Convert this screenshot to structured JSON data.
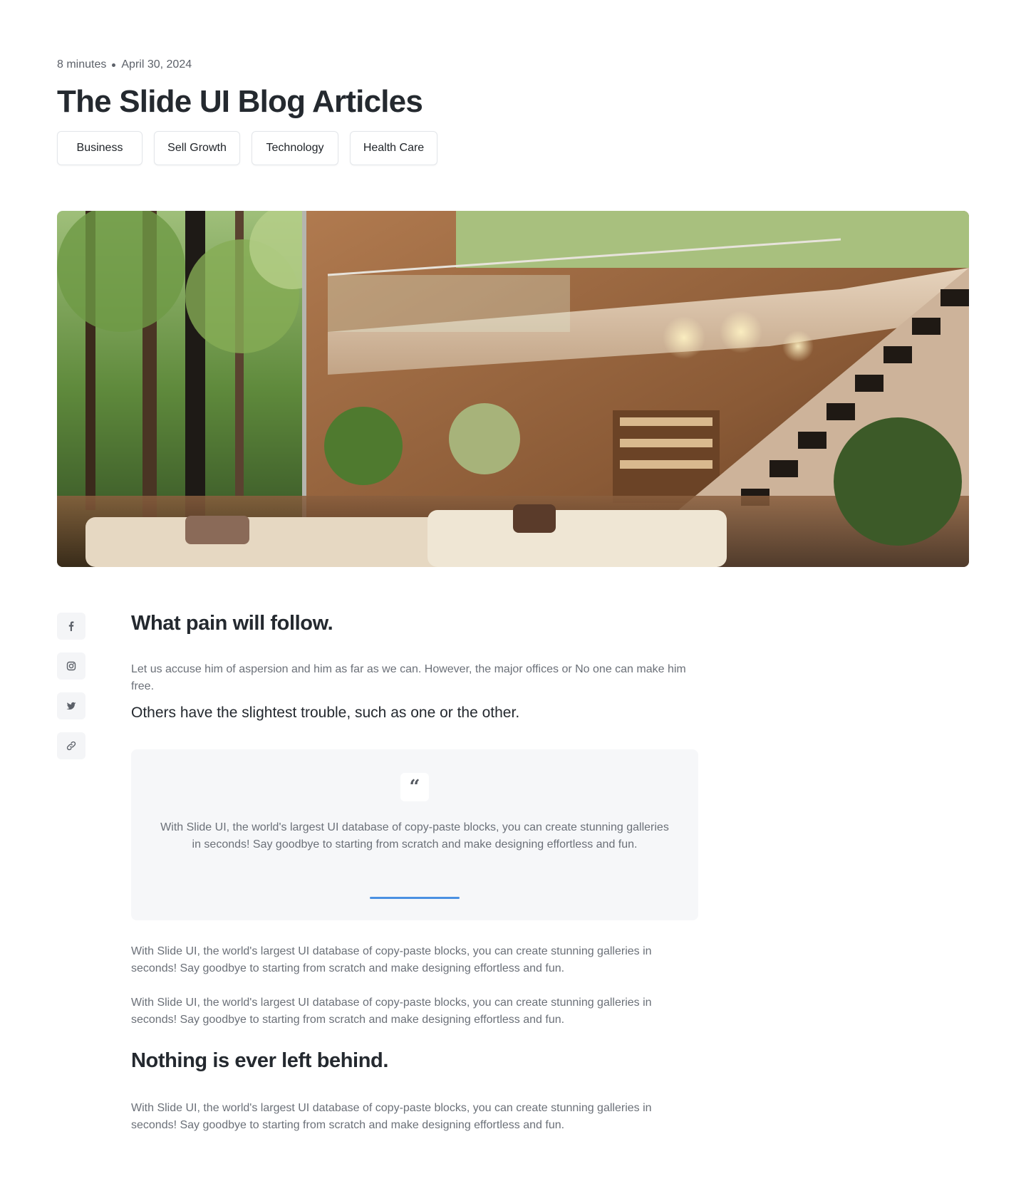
{
  "article": {
    "read_time": "8 minutes",
    "date": "April 30, 2024",
    "title": "The Slide UI Blog Articles",
    "tags": [
      "Business",
      "Sell Growth",
      "Technology",
      "Health Care"
    ]
  },
  "share": {
    "icons": [
      "facebook-icon",
      "instagram-icon",
      "twitter-icon",
      "link-icon"
    ]
  },
  "body": {
    "heading_1": "What pain will follow.",
    "paragraph_1": "Let us accuse him of aspersion and him as far as we can. However, the major offices or No one can make him free.",
    "lead": "Others have the slightest trouble, such as one or the other.",
    "quote": {
      "text": "With Slide UI, the world's largest UI database of copy-paste blocks, you can create stunning galleries in seconds! Say goodbye to starting from scratch and make designing effortless and fun.",
      "accent": "#4a90e2"
    },
    "paragraph_2": "With Slide UI, the world's largest UI database of copy-paste blocks, you can create stunning galleries in seconds! Say goodbye to starting from scratch and make designing effortless and fun.",
    "paragraph_3": "With Slide UI, the world's largest UI database of copy-paste blocks, you can create stunning galleries in seconds! Say goodbye to starting from scratch and make designing effortless and fun.",
    "heading_2": "Nothing is ever left behind.",
    "paragraph_4": "With Slide UI, the world's largest UI database of copy-paste blocks, you can create stunning galleries in seconds! Say goodbye to starting from scratch and make designing effortless and fun."
  }
}
